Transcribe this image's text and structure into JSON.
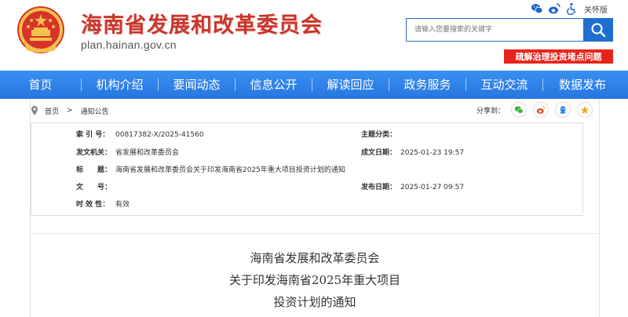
{
  "header": {
    "site_title": "海南省发展和改革委员会",
    "domain": "plan.hainan.gov.cn",
    "care_label": "关怀版",
    "search_placeholder": "请输入您要搜索的关键字",
    "red_banner": "疏解治理投资堵点问题"
  },
  "nav": {
    "items": [
      {
        "label": "首页"
      },
      {
        "label": "机构介绍"
      },
      {
        "label": "要闻动态"
      },
      {
        "label": "信息公开"
      },
      {
        "label": "解读回应"
      },
      {
        "label": "政务服务"
      },
      {
        "label": "互动交流"
      },
      {
        "label": "数据发布"
      }
    ]
  },
  "breadcrumb": {
    "home": "首页",
    "current": "通知公告"
  },
  "share": {
    "label": "分享到："
  },
  "meta": {
    "index_label": "索 引 号：",
    "index_value": "00817382-X/2025-41560",
    "topic_label": "主题分类：",
    "topic_value": "",
    "issuer_label": "发文机关：",
    "issuer_value": "省发展和改革委员会",
    "created_label": "成文日期：",
    "created_value": "2025-01-23 19:57",
    "title_label": "标　　题：",
    "title_value": "海南省发展和改革委员会关于印发海南省2025年重大项目投资计划的通知",
    "docno_label": "文　　号：",
    "docno_value": "",
    "published_label": "发布日期：",
    "published_value": "2025-01-27 09:57",
    "validity_label": "时 效 性：",
    "validity_value": "有效"
  },
  "document": {
    "title_line1": "海南省发展和改革委员会",
    "title_line2": "关于印发海南省2025年重大项目",
    "title_line3": "投资计划的通知"
  },
  "colors": {
    "brand_red": "#c8372c",
    "nav_blue": "#2677e1",
    "banner_red": "#e8231b"
  }
}
